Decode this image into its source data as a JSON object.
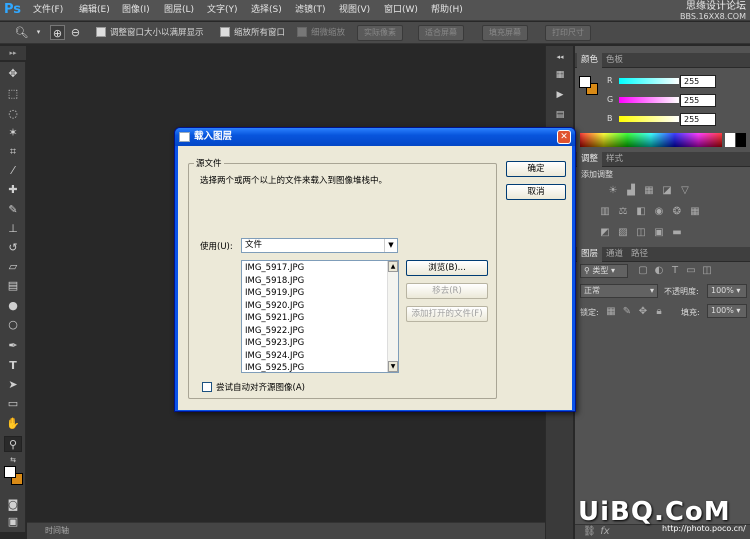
{
  "app": {
    "logo": "Ps"
  },
  "menu": [
    "文件(F)",
    "编辑(E)",
    "图像(I)",
    "图层(L)",
    "文字(Y)",
    "选择(S)",
    "滤镜(T)",
    "视图(V)",
    "窗口(W)",
    "帮助(H)"
  ],
  "watermark_top": {
    "line1": "思缘设计论坛",
    "line2": "BBS.16XX8.COM"
  },
  "options_bar": {
    "resize_windows": "调整窗口大小以满屏显示",
    "zoom_all": "缩放所有窗口",
    "scrubby_zoom": "细微缩放",
    "actual_pixels": "实际像素",
    "fit_screen": "适合屏幕",
    "fill_screen": "填充屏幕",
    "print_size": "打印尺寸"
  },
  "timeline": "时间轴",
  "color_panel": {
    "tabs": [
      "颜色",
      "色板"
    ],
    "channels": [
      {
        "label": "R",
        "value": "255"
      },
      {
        "label": "G",
        "value": "255"
      },
      {
        "label": "B",
        "value": "255"
      }
    ],
    "fg_color": "#ffffff",
    "bg_color": "#d98a16"
  },
  "adjustments_panel": {
    "tabs": [
      "调整",
      "样式"
    ],
    "title": "添加调整"
  },
  "layers_panel": {
    "tabs": [
      "图层",
      "通道",
      "路径"
    ],
    "kind_filter": "类型",
    "blend_mode": "正常",
    "opacity_label": "不透明度:",
    "opacity_value": "100%",
    "lock_label": "锁定:",
    "fill_label": "填充:",
    "fill_value": "100%"
  },
  "dialog": {
    "title": "载入图层",
    "close": "✕",
    "group_title": "源文件",
    "description": "选择两个或两个以上的文件来载入到图像堆栈中。",
    "use_label": "使用(U):",
    "use_value": "文件",
    "files": [
      "IMG_5917.JPG",
      "IMG_5918.JPG",
      "IMG_5919.JPG",
      "IMG_5920.JPG",
      "IMG_5921.JPG",
      "IMG_5922.JPG",
      "IMG_5923.JPG",
      "IMG_5924.JPG",
      "IMG_5925.JPG"
    ],
    "browse": "浏览(B)...",
    "remove": "移去(R)",
    "add_open": "添加打开的文件(F)",
    "ok": "确定",
    "cancel": "取消",
    "auto_align": "尝试自动对齐源图像(A)"
  },
  "watermark_bottom": {
    "logo": "UiBQ.CoM",
    "url": "http://photo.poco.cn/"
  }
}
